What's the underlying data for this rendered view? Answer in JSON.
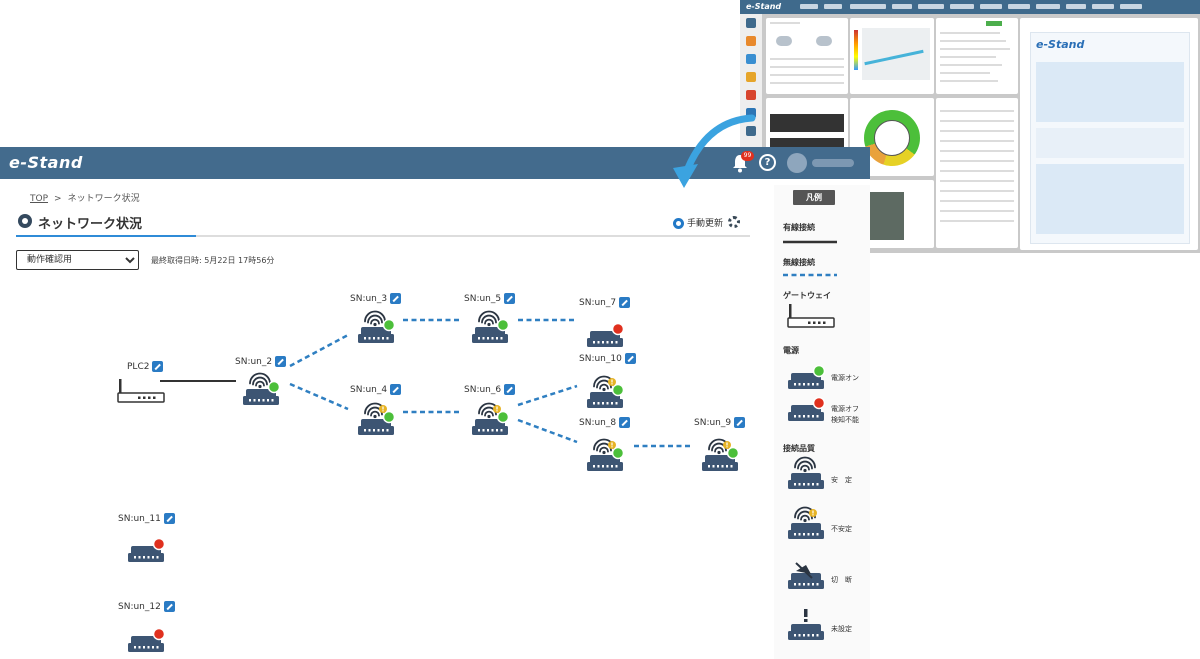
{
  "app": {
    "logo": "e-Stand"
  },
  "header": {
    "notification_count": "99",
    "help_label": "?"
  },
  "breadcrumb": {
    "home": "TOP",
    "separator": ">",
    "current": "ネットワーク状況"
  },
  "page": {
    "title": "ネットワーク状況",
    "refresh_label": "手動更新",
    "site_select_value": "動作確認用",
    "fetched_at": "最終取得日時: 5月22日 17時56分"
  },
  "nodes": [
    {
      "id": "PLC2",
      "kind": "gateway"
    },
    {
      "id": "SN:un_2",
      "kind": "sensor",
      "status": "stable"
    },
    {
      "id": "SN:un_3",
      "kind": "sensor",
      "status": "stable"
    },
    {
      "id": "SN:un_4",
      "kind": "sensor",
      "status": "unstable"
    },
    {
      "id": "SN:un_5",
      "kind": "sensor",
      "status": "stable"
    },
    {
      "id": "SN:un_6",
      "kind": "sensor",
      "status": "unstable"
    },
    {
      "id": "SN:un_7",
      "kind": "sensor",
      "status": "off"
    },
    {
      "id": "SN:un_8",
      "kind": "sensor",
      "status": "unstable"
    },
    {
      "id": "SN:un_9",
      "kind": "sensor",
      "status": "unstable"
    },
    {
      "id": "SN:un_10",
      "kind": "sensor",
      "status": "unstable"
    },
    {
      "id": "SN:un_11",
      "kind": "sensor",
      "status": "off"
    },
    {
      "id": "SN:un_12",
      "kind": "sensor",
      "status": "off"
    }
  ],
  "links": [
    {
      "from": "PLC2",
      "to": "SN:un_2",
      "type": "wired"
    },
    {
      "from": "SN:un_2",
      "to": "SN:un_3",
      "type": "wireless"
    },
    {
      "from": "SN:un_2",
      "to": "SN:un_4",
      "type": "wireless"
    },
    {
      "from": "SN:un_3",
      "to": "SN:un_5",
      "type": "wireless"
    },
    {
      "from": "SN:un_5",
      "to": "SN:un_7",
      "type": "wireless"
    },
    {
      "from": "SN:un_4",
      "to": "SN:un_6",
      "type": "wireless"
    },
    {
      "from": "SN:un_6",
      "to": "SN:un_10",
      "type": "wireless"
    },
    {
      "from": "SN:un_6",
      "to": "SN:un_8",
      "type": "wireless"
    },
    {
      "from": "SN:un_8",
      "to": "SN:un_9",
      "type": "wireless"
    }
  ],
  "legend": {
    "title": "凡例",
    "wired": "有線接続",
    "wireless": "無線接続",
    "gateway": "ゲートウェイ",
    "power": "電源",
    "power_on": "電源オン",
    "power_off_line1": "電源オフ",
    "power_off_line2": "検知不能",
    "quality": "接続品質",
    "stable": "安　定",
    "unstable": "不安定",
    "disconnected": "切　断",
    "unset": "未設定"
  },
  "colors": {
    "header": "#436b8d",
    "wired_line": "#333333",
    "wireless_line": "#2f7fc1",
    "device": "#3d5573",
    "status_ok": "#4cbf3a",
    "status_off": "#e0301e",
    "status_warn": "#e6b325",
    "accent": "#2f8bd7"
  }
}
